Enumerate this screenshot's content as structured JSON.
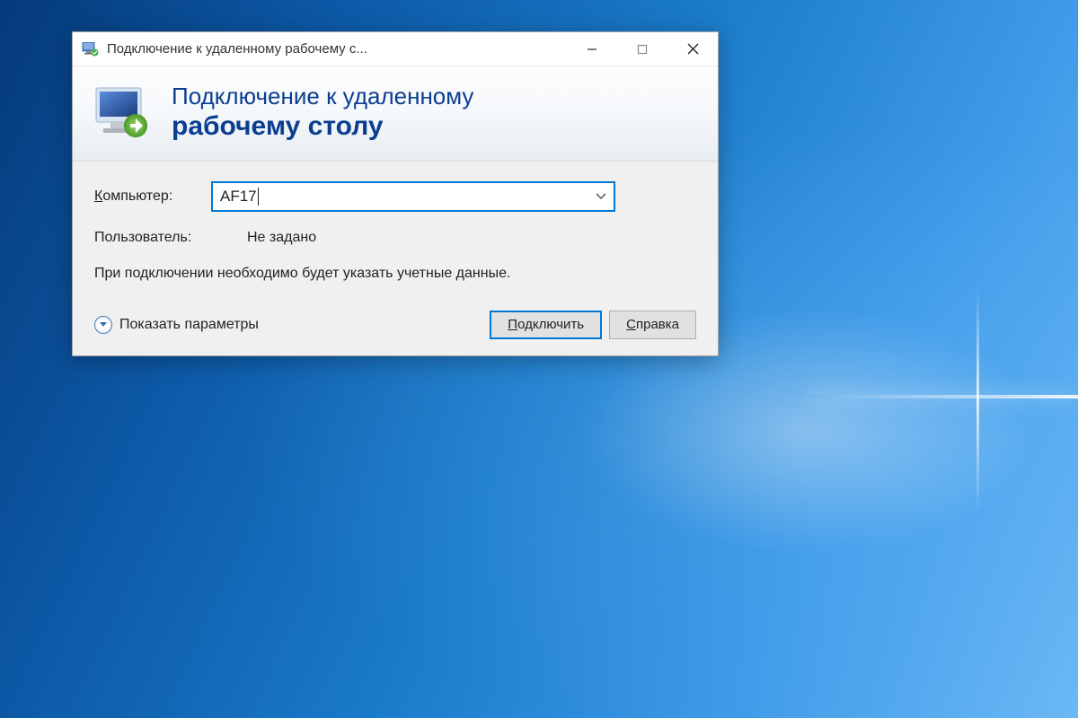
{
  "window": {
    "title": "Подключение к удаленному рабочему с..."
  },
  "banner": {
    "line1": "Подключение к удаленному",
    "line2": "рабочему столу"
  },
  "form": {
    "computer_label": "Компьютер:",
    "computer_value": "AF17",
    "user_label": "Пользователь:",
    "user_value": "Не задано",
    "info_text": "При подключении необходимо будет указать учетные данные."
  },
  "actions": {
    "show_options": "Показать параметры",
    "connect": "Подключить",
    "help": "Справка"
  }
}
